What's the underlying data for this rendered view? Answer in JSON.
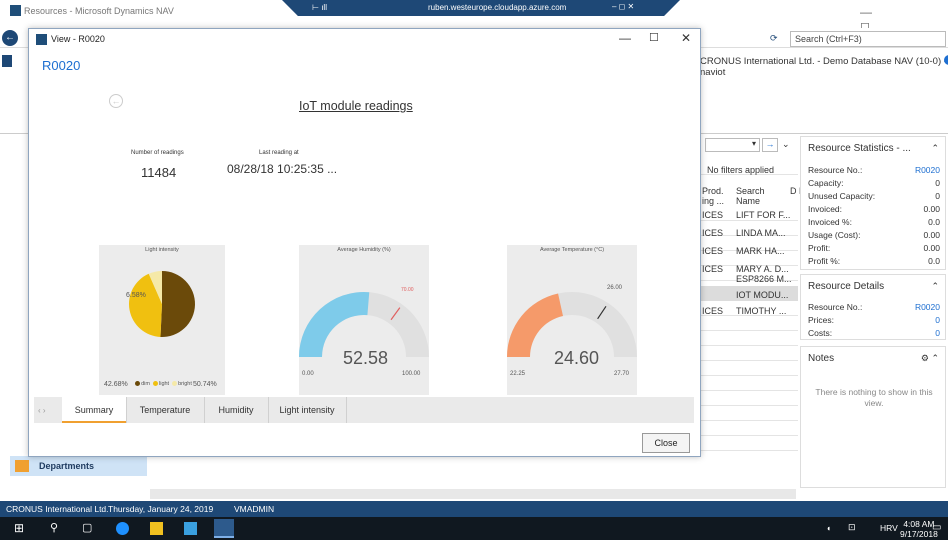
{
  "window": {
    "title": "Resources - Microsoft Dynamics NAV"
  },
  "rdp": {
    "host": "ruben.westeurope.cloudapp.azure.com"
  },
  "search": {
    "placeholder": "Search (Ctrl+F3)"
  },
  "company_line": "CRONUS International Ltd. - Demo Database NAV (10-0) - naviot",
  "list": {
    "filter_text": "No filters applied",
    "columns": {
      "prod": "Prod. ing ...",
      "search": "Search Name",
      "d": "D D"
    },
    "rows": [
      {
        "prod": "ICES",
        "name": "LIFT FOR F..."
      },
      {
        "prod": "ICES",
        "name": "LINDA MA..."
      },
      {
        "prod": "ICES",
        "name": "MARK HA..."
      },
      {
        "prod": "ICES",
        "name": "MARY A. D..."
      },
      {
        "prod": "",
        "name": "ESP8266 M..."
      },
      {
        "prod": "",
        "name": "IOT MODU..."
      },
      {
        "prod": "ICES",
        "name": "TIMOTHY ..."
      }
    ]
  },
  "resource_statistics": {
    "title": "Resource Statistics - ...",
    "rows": [
      {
        "label": "Resource No.:",
        "value": "R0020",
        "link": true
      },
      {
        "label": "Capacity:",
        "value": "0"
      },
      {
        "label": "Unused Capacity:",
        "value": "0"
      },
      {
        "label": "Invoiced:",
        "value": "0.00"
      },
      {
        "label": "Invoiced %:",
        "value": "0.0"
      },
      {
        "label": "Usage (Cost):",
        "value": "0.00"
      },
      {
        "label": "Profit:",
        "value": "0.00"
      },
      {
        "label": "Profit %:",
        "value": "0.0"
      }
    ]
  },
  "resource_details": {
    "title": "Resource Details",
    "rows": [
      {
        "label": "Resource No.:",
        "value": "R0020",
        "link": true
      },
      {
        "label": "Prices:",
        "value": "0",
        "link": true
      },
      {
        "label": "Costs:",
        "value": "0",
        "link": true
      }
    ]
  },
  "notes": {
    "title": "Notes",
    "empty": "There is nothing to show in this view."
  },
  "nav": {
    "departments": "Departments"
  },
  "status_bar": {
    "company": "CRONUS International Ltd.",
    "date": "Thursday, January 24, 2019",
    "user": "VMADMIN"
  },
  "taskbar": {
    "lang": "HRV",
    "time": "4:08 AM",
    "date": "9/17/2018"
  },
  "dialog": {
    "window_title": "View - R0020",
    "heading": "R0020",
    "iot_title": "IoT module readings",
    "readings_label": "Number of readings",
    "readings_value": "11484",
    "last_label": "Last reading at",
    "last_value": "08/28/18 10:25:35 ...",
    "tabs": [
      "Summary",
      "Temperature",
      "Humidity",
      "Light intensity"
    ],
    "close_label": "Close"
  },
  "light_chart": {
    "title": "Light intensity",
    "slices": [
      {
        "name": "dim",
        "percent": 50.74,
        "label": "50.74%",
        "color": "#6b4a0a"
      },
      {
        "name": "light",
        "percent": 42.68,
        "label": "42.68%",
        "color": "#f0c010"
      },
      {
        "name": "bright",
        "percent": 6.58,
        "label": "6.58%",
        "color": "#f5e9a8"
      }
    ],
    "legend": [
      "dim",
      "light",
      "bright"
    ]
  },
  "humidity_gauge": {
    "title": "Average Humidity (%)",
    "value": 52.58,
    "display": "52.58",
    "min": 0,
    "max": 100,
    "min_label": "0.00",
    "max_label": "100.00",
    "marker": 70,
    "marker_label": "70.00",
    "color": "#7ecbea"
  },
  "temperature_gauge": {
    "title": "Average Temperature (°C)",
    "value": 24.6,
    "display": "24.60",
    "min": 22.25,
    "max": 27.7,
    "min_label": "22.25",
    "max_label": "27.70",
    "marker": 26,
    "marker_label": "26.00",
    "color": "#f59a6a"
  }
}
